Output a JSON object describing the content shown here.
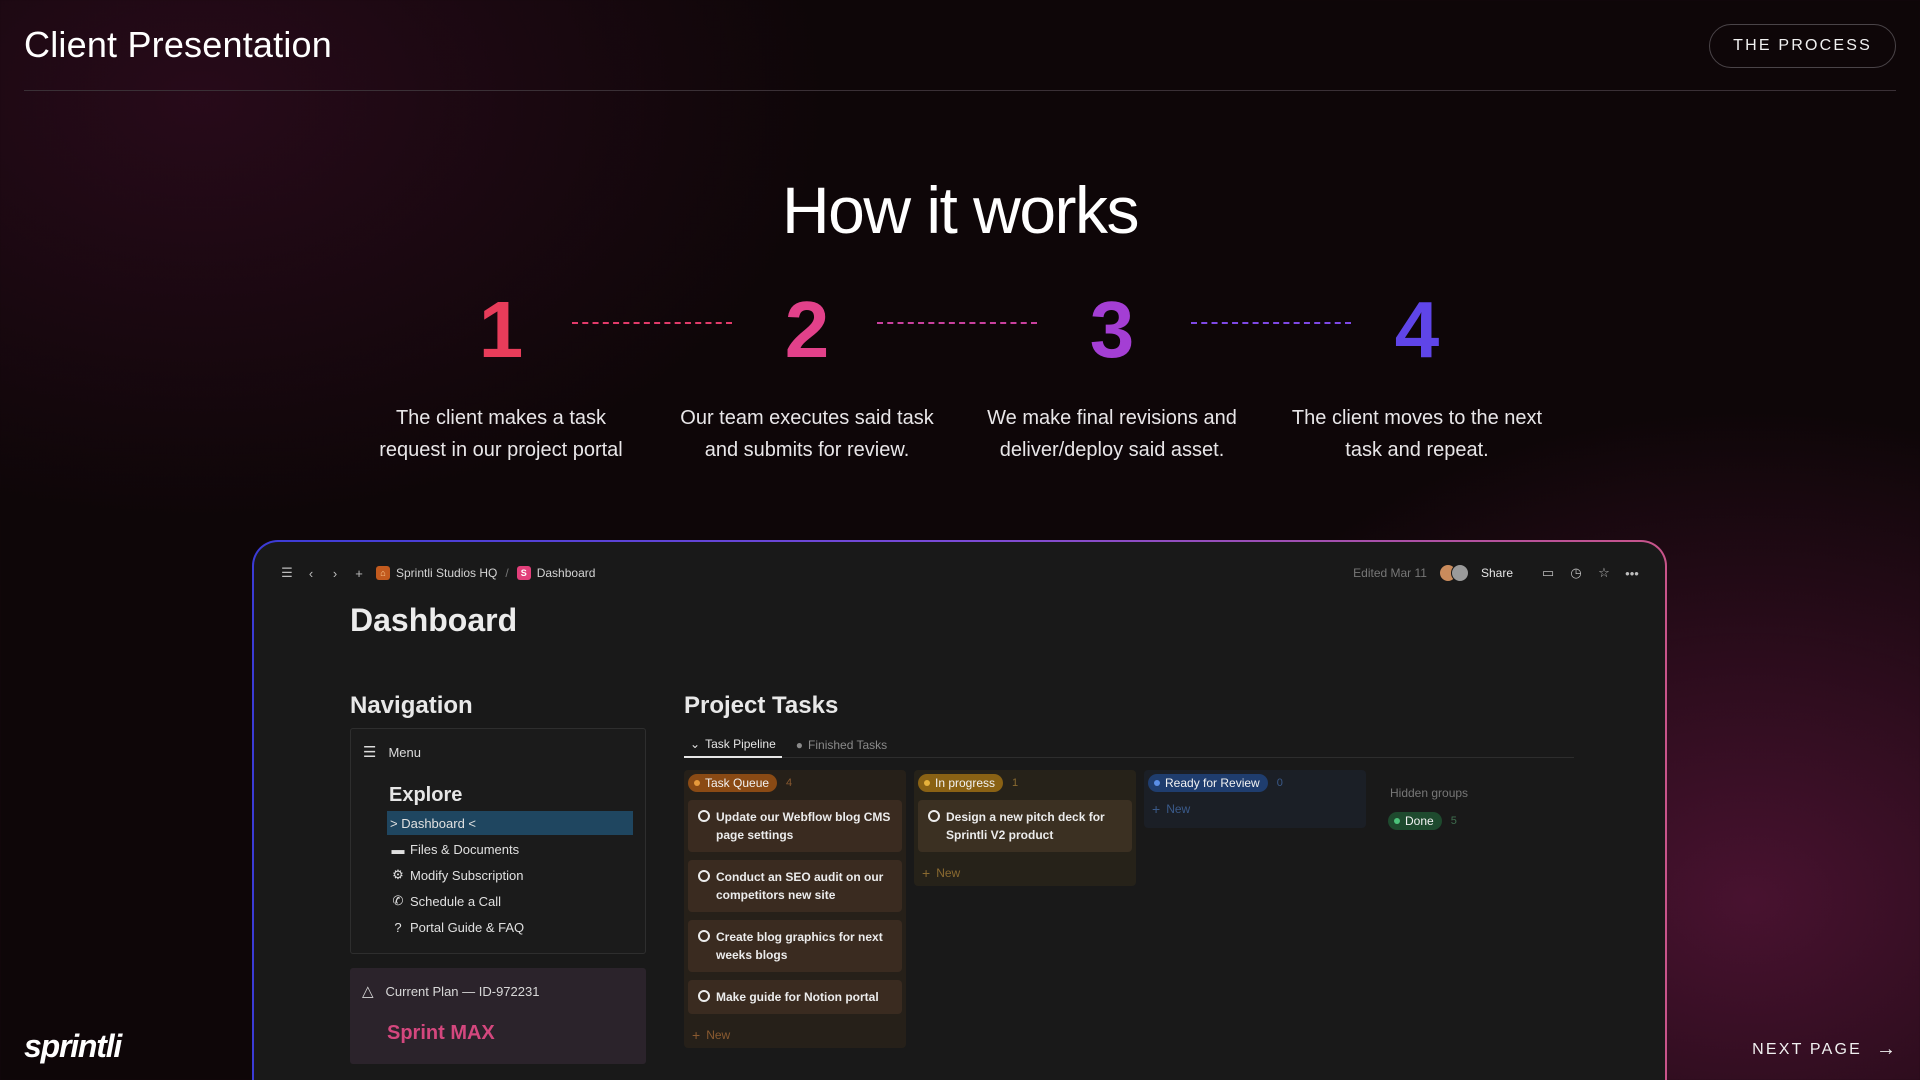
{
  "header": {
    "title": "Client Presentation",
    "process_button": "THE PROCESS"
  },
  "hero": {
    "heading": "How it works",
    "steps": [
      {
        "num": "1",
        "line1": "The client makes a task",
        "line2": "request in our project portal",
        "color": "#e83c5a"
      },
      {
        "num": "2",
        "line1": "Our team executes said task",
        "line2": "and submits for review.",
        "color": "#e2418a"
      },
      {
        "num": "3",
        "line1": "We make final revisions and",
        "line2": "deliver/deploy said asset.",
        "color": "#a43ed4"
      },
      {
        "num": "4",
        "line1": "The client moves to the next",
        "line2": "task and repeat.",
        "color": "#5f45e8"
      }
    ],
    "connector_colors": [
      "#e23a6a",
      "#c9409e",
      "#7f48e6"
    ]
  },
  "app": {
    "breadcrumb": {
      "workspace": "Sprintli Studios HQ",
      "separator": "/",
      "page": "Dashboard"
    },
    "edited": "Edited Mar 11",
    "share": "Share",
    "title": "Dashboard",
    "navigation": {
      "heading": "Navigation",
      "menu": "Menu",
      "explore": "Explore",
      "items": [
        {
          "label": "> Dashboard <",
          "icon": ""
        },
        {
          "label": "Files & Documents",
          "icon": "folder-icon"
        },
        {
          "label": "Modify Subscription",
          "icon": "gear-icon"
        },
        {
          "label": "Schedule a Call",
          "icon": "phone-icon"
        },
        {
          "label": "Portal Guide & FAQ",
          "icon": "question-icon"
        }
      ]
    },
    "plan": {
      "line": "Current Plan — ID-972231",
      "name": "Sprint MAX"
    },
    "project": {
      "heading": "Project Tasks",
      "tabs": [
        "Task Pipeline",
        "Finished Tasks"
      ],
      "columns": [
        {
          "label": "Task Queue",
          "count": "4",
          "pill_bg": "#8a4a14",
          "dot": "#e69a3c",
          "col_bg": "#262019",
          "card_bg": "#3a2b20",
          "count_color": "#8a5a30",
          "cards": [
            {
              "l1": "Update our Webflow blog CMS",
              "l2": "page settings"
            },
            {
              "l1": "Conduct an SEO audit on our",
              "l2": "competitors new site"
            },
            {
              "l1": "Create blog graphics for next",
              "l2": "weeks blogs"
            },
            {
              "l1": "Make guide for Notion portal",
              "l2": ""
            }
          ],
          "new": "New"
        },
        {
          "label": "In progress",
          "count": "1",
          "pill_bg": "#8a6214",
          "dot": "#e6b23c",
          "col_bg": "#262219",
          "card_bg": "#3b3022",
          "count_color": "#8a6a30",
          "cards": [
            {
              "l1": "Design a new pitch deck for",
              "l2": "Sprintli V2 product"
            }
          ],
          "new": "New"
        },
        {
          "label": "Ready for Review",
          "count": "0",
          "pill_bg": "#1f3d6e",
          "dot": "#5a8ee6",
          "col_bg": "#1b1f26",
          "card_bg": "#232a35",
          "count_color": "#3a5a8a",
          "cards": [],
          "new": "New"
        }
      ],
      "hidden_groups": "Hidden groups",
      "done": {
        "label": "Done",
        "count": "5"
      }
    }
  },
  "footer": {
    "logo": "sprintli",
    "next_page": "NEXT PAGE"
  }
}
